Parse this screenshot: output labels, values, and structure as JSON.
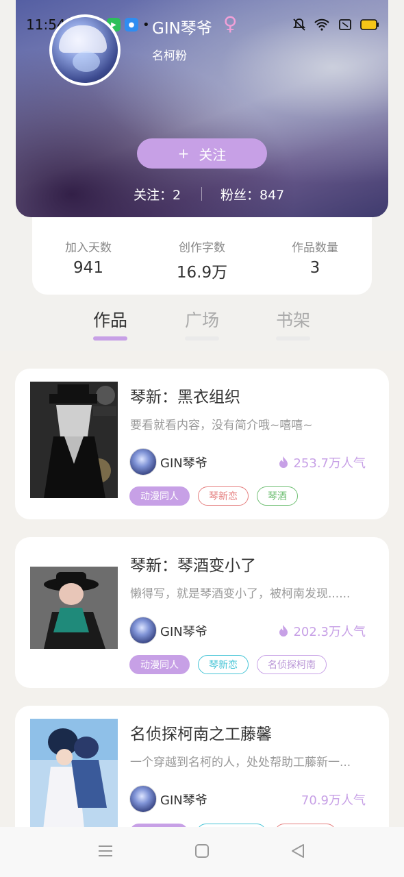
{
  "status": {
    "time": "11:54"
  },
  "profile": {
    "name": "GIN琴爷",
    "gender_symbol": "♀",
    "tag": "名柯粉",
    "follow_plus": "+",
    "follow_label": "关注",
    "following": "关注：2",
    "fans": "粉丝：847"
  },
  "stats": [
    {
      "label": "加入天数",
      "value": "941"
    },
    {
      "label": "创作字数",
      "value": "16.9万"
    },
    {
      "label": "作品数量",
      "value": "3"
    }
  ],
  "tabs": [
    {
      "label": "作品",
      "active": true
    },
    {
      "label": "广场",
      "active": false
    },
    {
      "label": "书架",
      "active": false
    }
  ],
  "works": [
    {
      "title": "琴新：黑衣组织",
      "desc": "要看就看内容，没有简介哦~嘻嘻~",
      "author": "GIN琴爷",
      "popularity": "253.7万人气",
      "tags": [
        {
          "label": "动漫同人",
          "color": "#c7a0e6",
          "filled": true
        },
        {
          "label": "琴新恋",
          "color": "#e57f7f",
          "filled": false
        },
        {
          "label": "琴酒",
          "color": "#6fbf73",
          "filled": false
        }
      ]
    },
    {
      "title": "琴新：琴酒变小了",
      "desc": "懒得写，就是琴酒变小了，被柯南发现......",
      "author": "GIN琴爷",
      "popularity": "202.3万人气",
      "tags": [
        {
          "label": "动漫同人",
          "color": "#c7a0e6",
          "filled": true
        },
        {
          "label": "琴新恋",
          "color": "#45c4d6",
          "filled": false
        },
        {
          "label": "名侦探柯南",
          "color": "#c7a0e6",
          "filled": false
        }
      ]
    },
    {
      "title": "名侦探柯南之工藤馨",
      "desc": "一个穿越到名柯的人，处处帮助工藤新一...",
      "author": "GIN琴爷",
      "popularity": "70.9万人气",
      "tags": []
    }
  ],
  "colors": {
    "accent": "#c7a0e6",
    "background": "#f2f1ee"
  }
}
